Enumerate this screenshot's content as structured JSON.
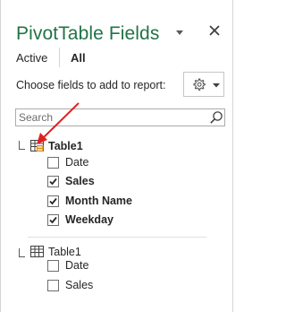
{
  "panel": {
    "title": "PivotTable Fields",
    "title_color": "#217346",
    "tabs": [
      {
        "label": "Active",
        "selected": false
      },
      {
        "label": "All",
        "selected": true
      }
    ],
    "choose_text": "Choose fields to add to report:",
    "gear_icon": "gear-icon",
    "dropdown_icon": "chevron-down-icon",
    "close_icon": "close-icon",
    "search": {
      "placeholder": "Search",
      "value": ""
    }
  },
  "tables": [
    {
      "name": "Table1",
      "bold": true,
      "active": true,
      "fields": [
        {
          "label": "Date",
          "checked": false
        },
        {
          "label": "Sales",
          "checked": true
        },
        {
          "label": "Month Name",
          "checked": true
        },
        {
          "label": "Weekday",
          "checked": true
        }
      ]
    },
    {
      "name": "Table1",
      "bold": false,
      "active": false,
      "fields": [
        {
          "label": "Date",
          "checked": false
        },
        {
          "label": "Sales",
          "checked": false
        }
      ]
    }
  ],
  "annotation": {
    "arrow_color": "#e02020"
  }
}
